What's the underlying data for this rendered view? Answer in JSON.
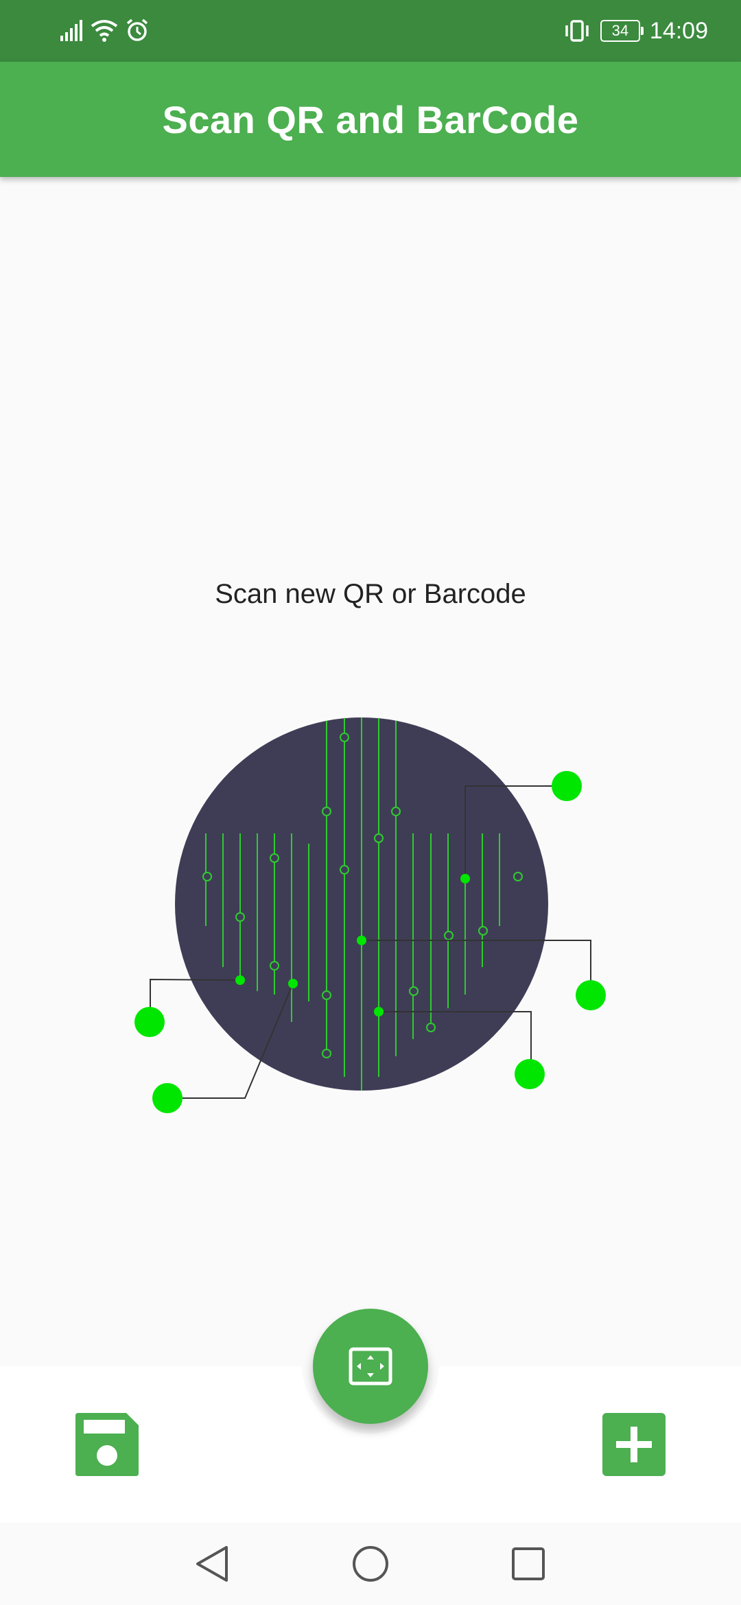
{
  "status_bar": {
    "time": "14:09",
    "battery_level": "34",
    "icons": [
      "signal-icon",
      "wifi-icon",
      "alarm-icon",
      "vibrate-icon",
      "battery-icon"
    ]
  },
  "app_bar": {
    "title": "Scan QR and BarCode"
  },
  "main": {
    "prompt": "Scan new QR or Barcode"
  },
  "bottom_bar": {
    "left_icon": "save-icon",
    "center_icon": "scan-frame-icon",
    "right_icon": "add-icon"
  },
  "nav_bar": {
    "buttons": [
      "back-icon",
      "home-icon",
      "recents-icon"
    ]
  },
  "colors": {
    "status_bar": "#3b8a3e",
    "primary": "#4caf50",
    "circle": "#3f3d56",
    "node": "#00e600",
    "background": "#fafafa"
  }
}
